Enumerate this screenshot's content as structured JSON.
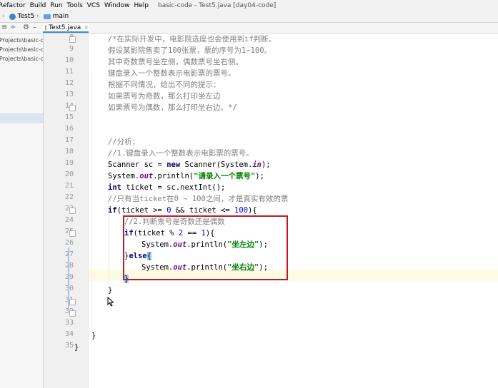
{
  "menu": {
    "items": [
      "Refactor",
      "Build",
      "Run",
      "Tools",
      "VCS",
      "Window",
      "Help"
    ],
    "window_title": "basic-code - Test5.java [day04-code]"
  },
  "nav": {
    "class_name": "Test5",
    "method_name": "main"
  },
  "toolbar": {
    "tool_icons": [
      "sync-icon",
      "gear-icon",
      "minimize-icon"
    ]
  },
  "editor_tab": {
    "label": "Test5.java"
  },
  "project_panel": {
    "items": [
      "aProjects\\basic-co",
      "aProjects\\basic-co",
      "aProjects\\basic-co"
    ]
  },
  "editor": {
    "line_numbers": [
      "8",
      "9",
      "10",
      "11",
      "12",
      "13",
      "14",
      "15",
      "16",
      "17",
      "18",
      "19",
      "20",
      "21",
      "22",
      "23",
      "24",
      "25",
      "26",
      "27",
      "28",
      "29",
      "30",
      "31",
      "32",
      "33",
      "34",
      "35"
    ],
    "highlight_color": "#c0182b"
  }
}
